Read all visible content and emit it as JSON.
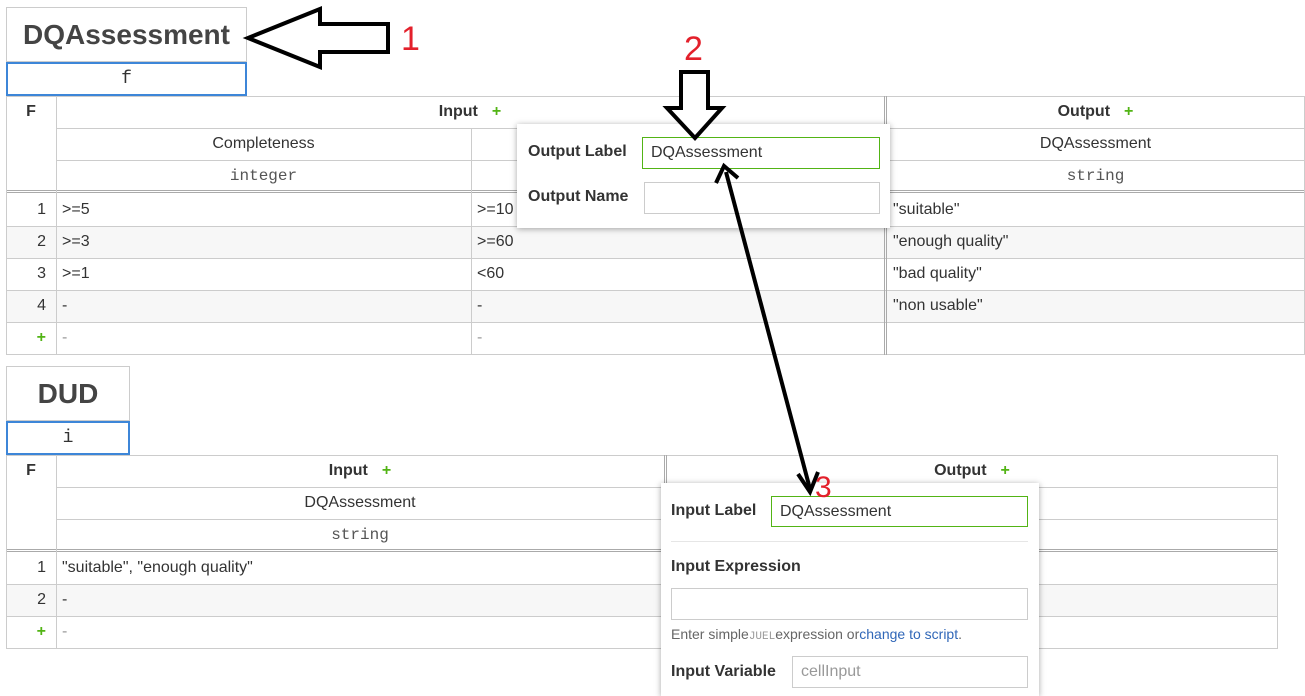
{
  "table1": {
    "name": "DQAssessment",
    "hit_policy": "f",
    "hit_policy_header": "F",
    "input_header": "Input",
    "output_header": "Output",
    "add_symbol": "+",
    "inputs": [
      {
        "label": "Completeness",
        "type": "integer"
      }
    ],
    "output": {
      "label": "DQAssessment",
      "type": "string"
    },
    "rules": [
      {
        "n": "1",
        "c1": ">=5",
        "c2": ">=10",
        "out": "\"suitable\""
      },
      {
        "n": "2",
        "c1": ">=3",
        "c2": ">=60",
        "out": "\"enough quality\""
      },
      {
        "n": "3",
        "c1": ">=1",
        "c2": "<60",
        "out": "\"bad quality\""
      },
      {
        "n": "4",
        "c1": "-",
        "c2": "-",
        "out": "\"non usable\""
      }
    ],
    "new_row": {
      "add": "+",
      "c1": "-",
      "c2": "-"
    }
  },
  "output_popup": {
    "output_label_label": "Output Label",
    "output_label_value": "DQAssessment",
    "output_name_label": "Output Name",
    "output_name_value": ""
  },
  "table2": {
    "name": "DUD",
    "hit_policy": "i",
    "hit_policy_header": "F",
    "input_header": "Input",
    "output_header": "Output",
    "add_symbol": "+",
    "input": {
      "label": "DQAssessment",
      "type": "string"
    },
    "rules": [
      {
        "n": "1",
        "c1": "\"suitable\", \"enough quality\""
      },
      {
        "n": "2",
        "c1": "-"
      }
    ],
    "new_row": {
      "add": "+",
      "c1": "-"
    }
  },
  "input_popup": {
    "input_label_label": "Input Label",
    "input_label_value": "DQAssessment",
    "input_expression_label": "Input Expression",
    "input_expression_value": "",
    "hint_prefix": "Enter simple",
    "hint_code": "JUEL",
    "hint_middle": "expression or",
    "hint_link": "change to script",
    "hint_suffix": ".",
    "input_variable_label": "Input Variable",
    "input_variable_placeholder": "cellInput"
  },
  "annotations": {
    "a1": "1",
    "a2": "2",
    "a3": "3"
  },
  "colors": {
    "accent_green": "#52b415",
    "selection_blue": "#3d86d8",
    "annotation_red": "#e3202b",
    "link_blue": "#3067b8"
  }
}
